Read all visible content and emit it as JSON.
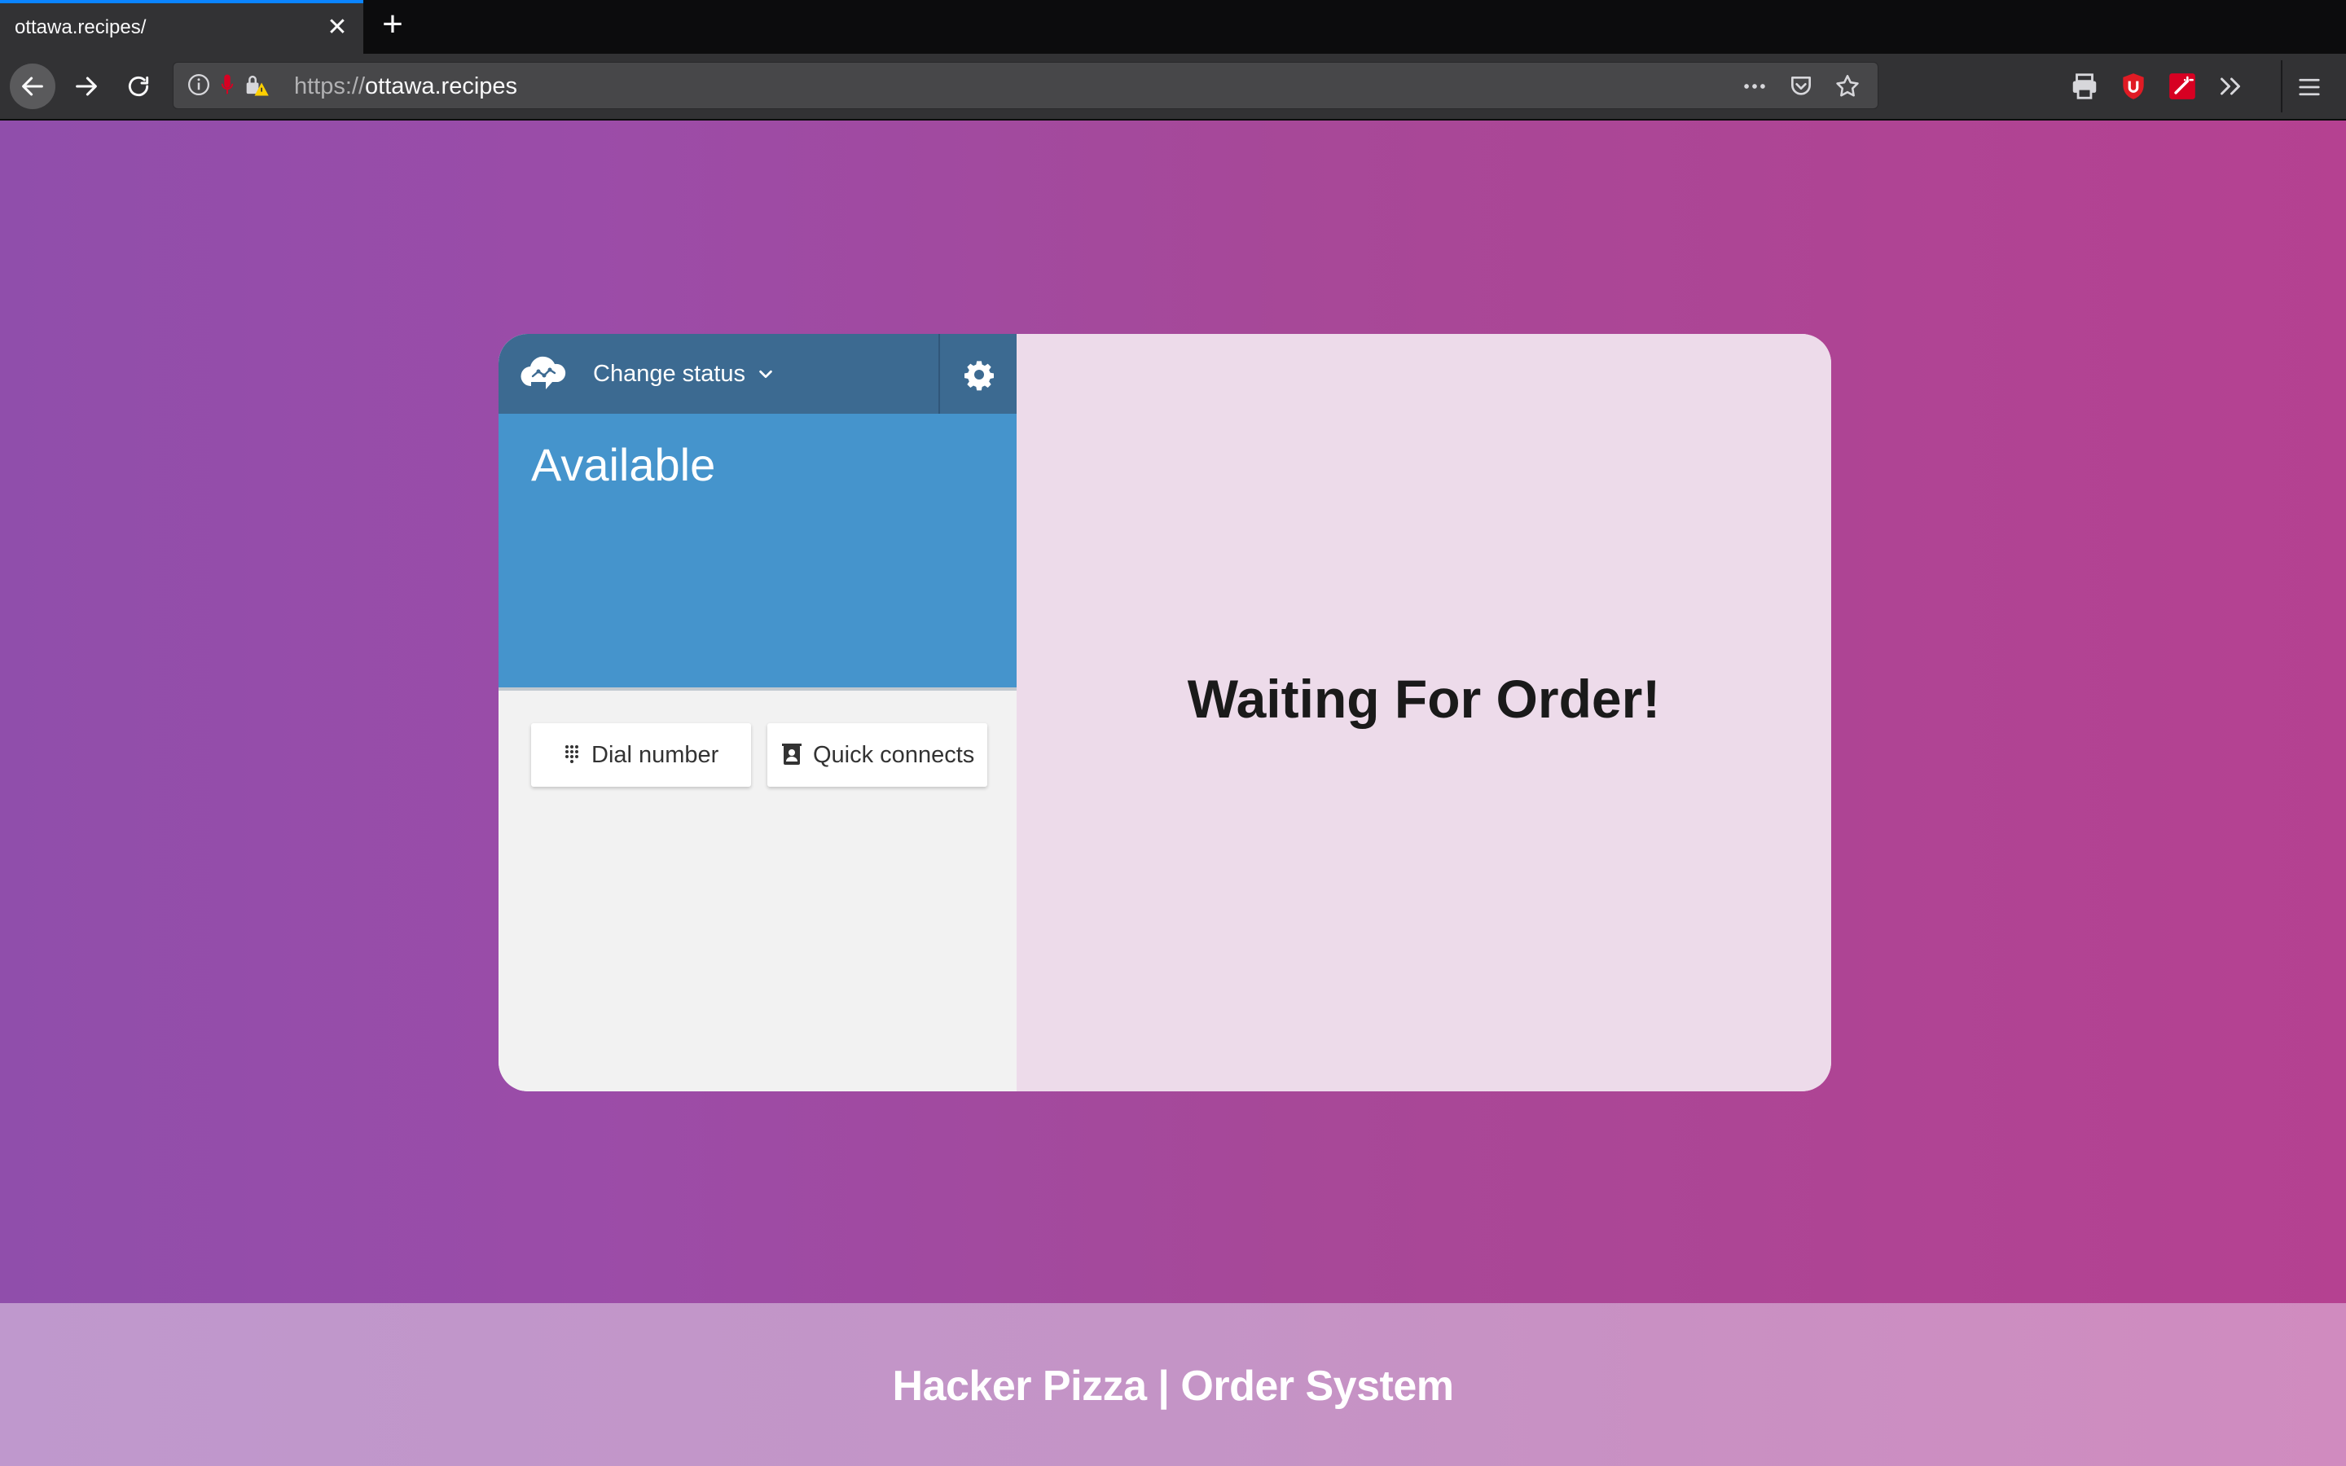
{
  "browser": {
    "tab_title": "ottawa.recipes/",
    "tab_close_glyph": "✕",
    "new_tab_glyph": "+",
    "url_protocol": "https://",
    "url_host": "ottawa.recipes",
    "accent_color": "#0a84ff"
  },
  "ccp": {
    "change_status_label": "Change status",
    "status": "Available",
    "dial_label": "Dial number",
    "quick_connects_label": "Quick connects",
    "header_color": "#3c6a91",
    "status_color": "#4594cc"
  },
  "order": {
    "title": "Waiting For Order!"
  },
  "footer": {
    "text": "Hacker Pizza | Order System"
  }
}
